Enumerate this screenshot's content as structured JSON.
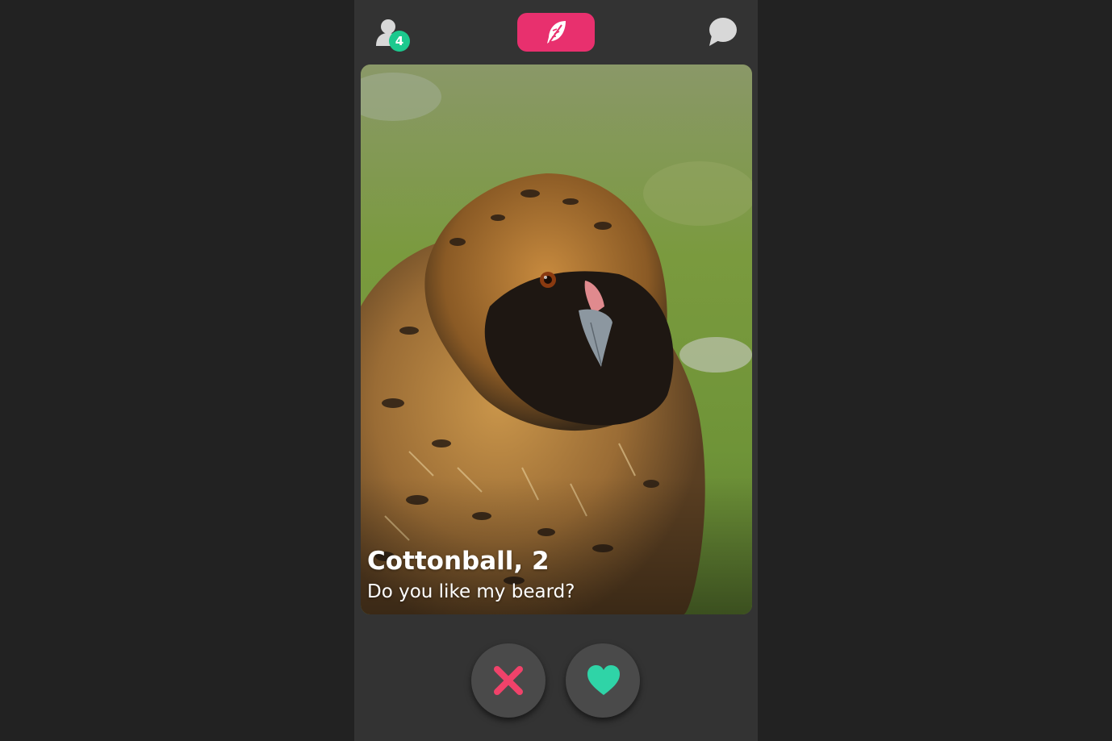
{
  "header": {
    "match_count": "4",
    "profile_icon": "user-icon",
    "logo_icon": "feather-icon",
    "chat_icon": "speech-bubble-icon"
  },
  "card": {
    "name_age": "Cottonball, 2",
    "bio": "Do you like my beard?"
  },
  "actions": {
    "dislike_icon": "x-icon",
    "like_icon": "heart-icon"
  },
  "colors": {
    "accent": "#e8306e",
    "badge": "#1cc98e",
    "dislike": "#f0426a",
    "like": "#2fd4a7",
    "panel": "#333333",
    "page_background": "#222222"
  }
}
